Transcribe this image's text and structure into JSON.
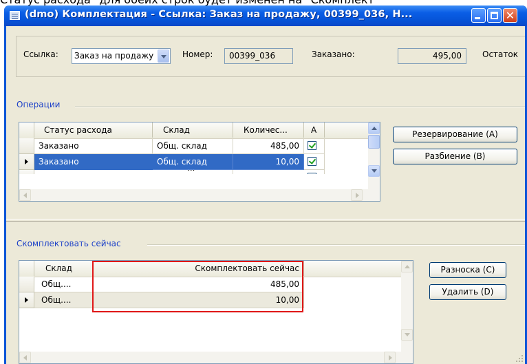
{
  "caption": "Статус расхода\" для обеих строк будет изменен на \"Скомплект",
  "window": {
    "title": "(dmo) Комплектация - Ссылка: Заказ на продажу, 00399_036, Н...",
    "icons": [
      "window-menu-icon",
      "minimize-icon",
      "maximize-icon",
      "close-icon"
    ]
  },
  "header": {
    "link_label": "Ссылка:",
    "link_value": "Заказ на продажу",
    "number_label": "Номер:",
    "number_value": "00399_036",
    "ordered_label": "Заказано:",
    "ordered_value": "495,00",
    "remaining_label": "Остаток"
  },
  "operations": {
    "group_title": "Операции",
    "columns": [
      "Статус расхода",
      "Склад",
      "Количес...",
      "А"
    ],
    "rows": [
      {
        "status": "Заказано",
        "warehouse": "Общ. склад",
        "quantity": "485,00",
        "checked": true,
        "selected": false,
        "current": false
      },
      {
        "status": "Заказано",
        "warehouse": "Общ. склад",
        "quantity": "10,00",
        "checked": true,
        "selected": true,
        "current": true
      }
    ],
    "partial_row_text": "...",
    "buttons": {
      "reserve": "Резервирование (А)",
      "split": "Разбиение (В)"
    }
  },
  "pick_now": {
    "group_title": "Скомплектовать сейчас",
    "columns": [
      "Склад",
      "Скомплектовать сейчас"
    ],
    "rows": [
      {
        "warehouse": "Общ....",
        "amount": "485,00",
        "current": false
      },
      {
        "warehouse": "Общ....",
        "amount": "10,00",
        "current": true
      }
    ],
    "buttons": {
      "post": "Разноска (С)",
      "delete": "Удалить (D)"
    }
  },
  "colors": {
    "titlebar": "#0654d8",
    "selection": "#316ac5",
    "group_title": "#1e42c8",
    "highlight_box": "#e01818",
    "face": "#ece9d8"
  }
}
